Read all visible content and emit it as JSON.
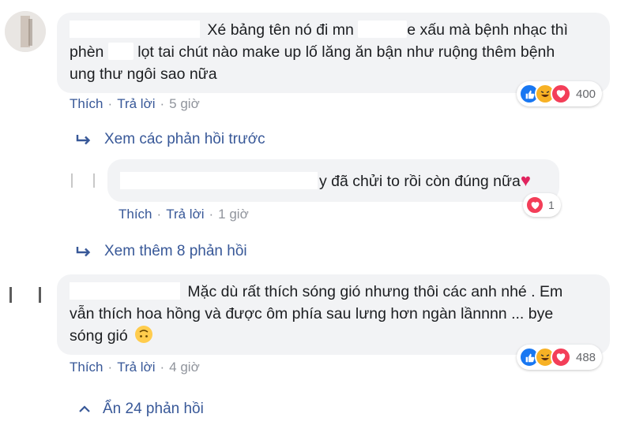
{
  "comments": [
    {
      "text_line1": "Xé bảng tên nó đi mn",
      "text_line1b": "e xấu mà bệnh nhạc thì",
      "text_line2a": "phèn",
      "text_line2b": "lọt tai chút nào make up lố lăng ăn bận như ruộng thêm bệnh",
      "text_line3": "ung thư ngôi sao nữa",
      "actions": {
        "like": "Thích",
        "reply": "Trả lời",
        "time": "5 giờ"
      },
      "reactions": {
        "icons": [
          "like-icon",
          "haha-icon",
          "love-icon"
        ],
        "count": "400"
      }
    },
    {
      "text_line1a": "Mặc dù rất thích sóng gió nhưng thôi các anh nhé . Em",
      "text_line2": "vẫn thích hoa hồng và được ôm phía sau lưng hơn ngàn lầnnnn ... bye",
      "text_line3": "sóng gió",
      "actions": {
        "like": "Thích",
        "reply": "Trả lời",
        "time": "4 giờ"
      },
      "reactions": {
        "icons": [
          "like-icon",
          "haha-icon",
          "love-icon"
        ],
        "count": "488"
      }
    }
  ],
  "view_previous": "Xem các phản hồi trước",
  "reply": {
    "text": "y đã chửi to rồi còn đúng nữa",
    "actions": {
      "like": "Thích",
      "reply": "Trả lời",
      "time": "1 giờ"
    },
    "reaction_count": "1"
  },
  "view_more": "Xem thêm 8 phản hồi",
  "hide_replies": "Ẩn 24 phản hồi",
  "colors": {
    "link_blue": "#385898",
    "bubble_bg": "#f2f3f5",
    "meta_gray": "#90949c",
    "like_blue": "#1877f2",
    "haha_yellow": "#f7b125",
    "love_red": "#f33e58"
  }
}
